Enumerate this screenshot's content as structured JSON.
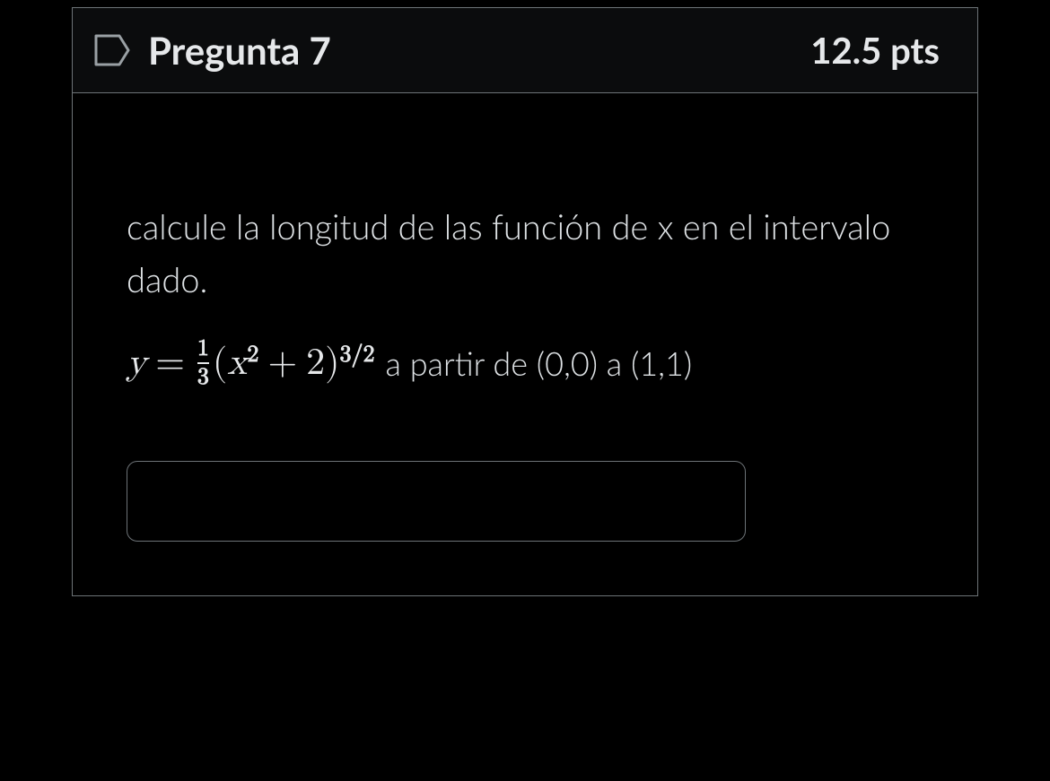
{
  "question": {
    "title": "Pregunta 7",
    "points": "12.5 pts",
    "prompt": "calcule la longitud de las función de x en el intervalo dado.",
    "equation": {
      "lhs_var": "y",
      "equals": "=",
      "frac_num": "1",
      "frac_den": "3",
      "open_paren": "(",
      "base_var": "x",
      "base_exp": "2",
      "plus": "+",
      "constant": "2",
      "close_paren": ")",
      "outer_exp": "3/2"
    },
    "range_text": "a partir de (0,0) a (1,1)",
    "answer_value": ""
  }
}
